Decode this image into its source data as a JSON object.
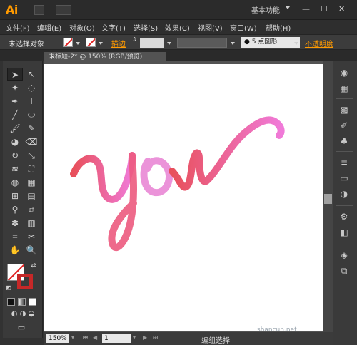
{
  "app": {
    "logo": "Ai",
    "workspace": "基本功能",
    "window_controls": [
      "—",
      "☐",
      "✕"
    ]
  },
  "menu": [
    "文件(F)",
    "编辑(E)",
    "对象(O)",
    "文字(T)",
    "选择(S)",
    "效果(C)",
    "视图(V)",
    "窗口(W)",
    "帮助(H)"
  ],
  "control_bar": {
    "selection_label": "未选择对象",
    "stroke_link": "描边",
    "brush_value": "5 点圆形",
    "opacity_link": "不透明度"
  },
  "document": {
    "tab_title": "未标题-2* @ 150% (RGB/预览)",
    "close_glyph": "×"
  },
  "status_bar": {
    "zoom": "150%",
    "page": "1",
    "status_text": "编组选择"
  },
  "artwork": {
    "stroke_color_start": "#e8505b",
    "stroke_color_end": "#f07ad8"
  },
  "watermark": "shancun.net"
}
